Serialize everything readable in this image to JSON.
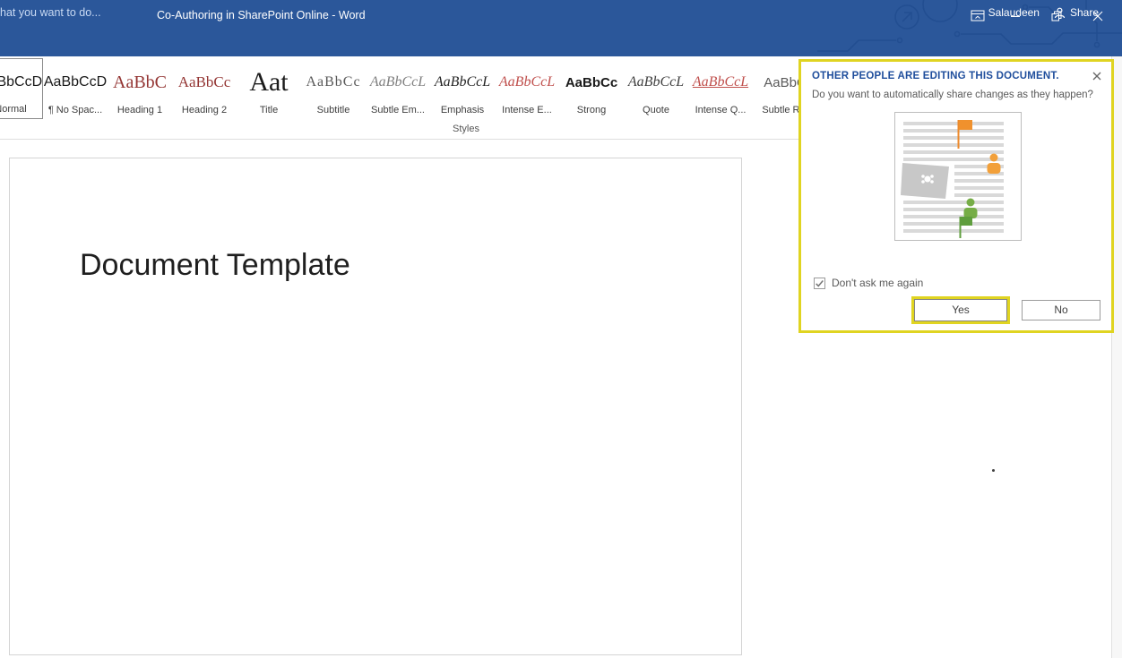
{
  "window": {
    "title": "Co-Authoring in SharePoint Online - Word"
  },
  "tab_row": {
    "tell_me_text": "hat you want to do...",
    "user_name": "Salaudeen",
    "share_label": "Share"
  },
  "ribbon": {
    "group_label": "Styles",
    "styles": [
      {
        "preview": "AaBbCcD",
        "label": "Normal"
      },
      {
        "preview": "AaBbCcD",
        "label": "¶ No Spac..."
      },
      {
        "preview": "AaBbC",
        "label": "Heading 1"
      },
      {
        "preview": "AaBbCc",
        "label": "Heading 2"
      },
      {
        "preview": "Aat",
        "label": "Title"
      },
      {
        "preview": "AaBbCc",
        "label": "Subtitle"
      },
      {
        "preview": "AaBbCcL",
        "label": "Subtle Em..."
      },
      {
        "preview": "AaBbCcL",
        "label": "Emphasis"
      },
      {
        "preview": "AaBbCcL",
        "label": "Intense E..."
      },
      {
        "preview": "AaBbCc",
        "label": "Strong"
      },
      {
        "preview": "AaBbCcL",
        "label": "Quote"
      },
      {
        "preview": "AaBbCcL",
        "label": "Intense Q..."
      },
      {
        "preview": "AaBbC",
        "label": "Subtle R..."
      }
    ]
  },
  "document": {
    "title_text": "Document Template"
  },
  "popup": {
    "heading": "OTHER PEOPLE ARE EDITING THIS DOCUMENT.",
    "question": "Do you want to automatically share changes as they happen?",
    "checkbox_label": "Don't ask me again",
    "checkbox_checked": true,
    "yes_label": "Yes",
    "no_label": "No"
  },
  "colors": {
    "titlebar_blue": "#2b579a",
    "popup_heading_blue": "#1f4e9c",
    "annotation_yellow": "#e0d421",
    "heading_style_red": "#943634",
    "intense_style_red": "#c0504d",
    "flag_orange": "#ed8a2b",
    "flag_green": "#5f9e3e"
  }
}
